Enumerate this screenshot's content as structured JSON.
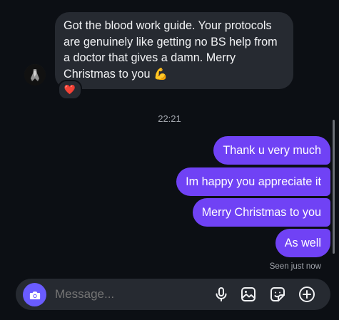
{
  "incoming": {
    "text": "Got the blood work guide. Your protocols are genuinely like getting no BS help from a doctor that gives a damn. Merry Christmas to you",
    "emoji": "💪",
    "reaction": "❤️"
  },
  "timestamp": "22:21",
  "outgoing": [
    "Thank u very much",
    "Im happy you appreciate it",
    "Merry Christmas to you",
    "As well"
  ],
  "seen_status": "Seen just now",
  "composer": {
    "placeholder": "Message..."
  },
  "icons": {
    "camera": "camera-icon",
    "mic": "microphone-icon",
    "gallery": "gallery-icon",
    "sticker": "sticker-icon",
    "add": "plus-circle-icon"
  },
  "colors": {
    "background": "#0c0f14",
    "incoming_bubble": "#262a31",
    "outgoing_bubble": "#7042f5",
    "camera_button": "#6a5cff",
    "muted_text": "#a0a4ab"
  }
}
